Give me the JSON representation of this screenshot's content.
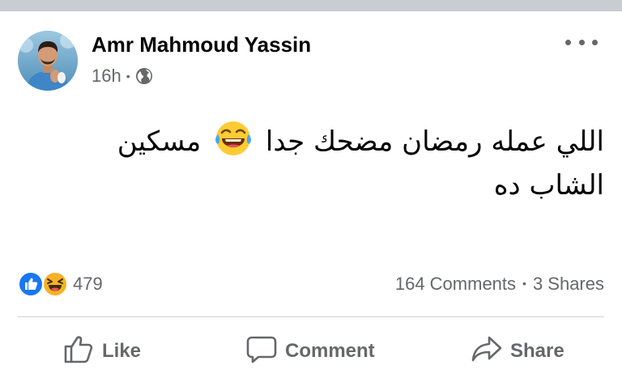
{
  "post": {
    "author": "Amr Mahmoud Yassin",
    "time": "16h",
    "separator": "•",
    "privacy_icon": "globe-icon",
    "more_icon": "more-options-icon",
    "text_part1": "اللي عمله رمضان مضحك جدا",
    "emoji": "laughing-tears-emoji",
    "text_part2": "مسكين الشاب ده"
  },
  "stats": {
    "reaction_icons": [
      "like-reaction-icon",
      "haha-reaction-icon"
    ],
    "reaction_count": "479",
    "comments": "164 Comments",
    "separator": "•",
    "shares": "3 Shares"
  },
  "actions": {
    "like_label": "Like",
    "comment_label": "Comment",
    "share_label": "Share"
  },
  "colors": {
    "secondary_text": "#65676b",
    "like_blue": "#1877f2",
    "haha_yellow": "#f7b125",
    "divider": "#ced0d4"
  }
}
